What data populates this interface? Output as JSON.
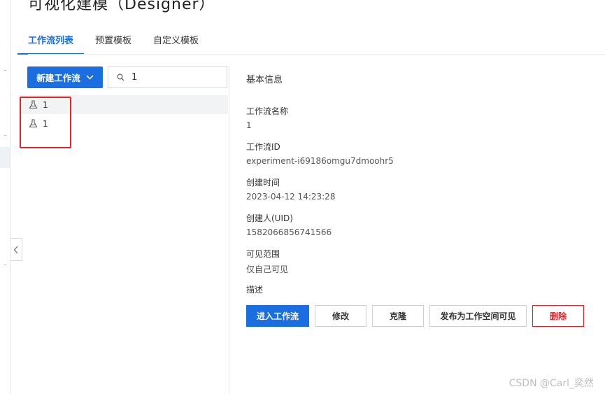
{
  "page": {
    "title": "可视化建模（Designer）"
  },
  "tabs": [
    {
      "label": "工作流列表",
      "active": true
    },
    {
      "label": "预置模板",
      "active": false
    },
    {
      "label": "自定义模板",
      "active": false
    }
  ],
  "toolbar": {
    "new_button_label": "新建工作流",
    "search_value": "1"
  },
  "workflows": [
    {
      "name": "1",
      "icon": "flask-icon",
      "selected": true
    },
    {
      "name": "1",
      "icon": "flask-icon",
      "selected": false
    }
  ],
  "detail": {
    "section_title": "基本信息",
    "fields": [
      {
        "label": "工作流名称",
        "value": "1"
      },
      {
        "label": "工作流ID",
        "value": "experiment-i69186omgu7dmoohr5"
      },
      {
        "label": "创建时间",
        "value": "2023-04-12 14:23:28"
      },
      {
        "label": "创建人(UID)",
        "value": "1582066856741566"
      },
      {
        "label": "可见范围",
        "value": "仅自己可见"
      },
      {
        "label": "描述",
        "value": ""
      }
    ]
  },
  "actions": {
    "enter": "进入工作流",
    "edit": "修改",
    "clone": "克隆",
    "publish": "发布为工作空间可见",
    "delete": "删除"
  },
  "watermark": "CSDN @Carl_奕然",
  "colors": {
    "primary": "#1a6ee0",
    "danger": "#e0262b",
    "highlight": "#e0262b"
  }
}
